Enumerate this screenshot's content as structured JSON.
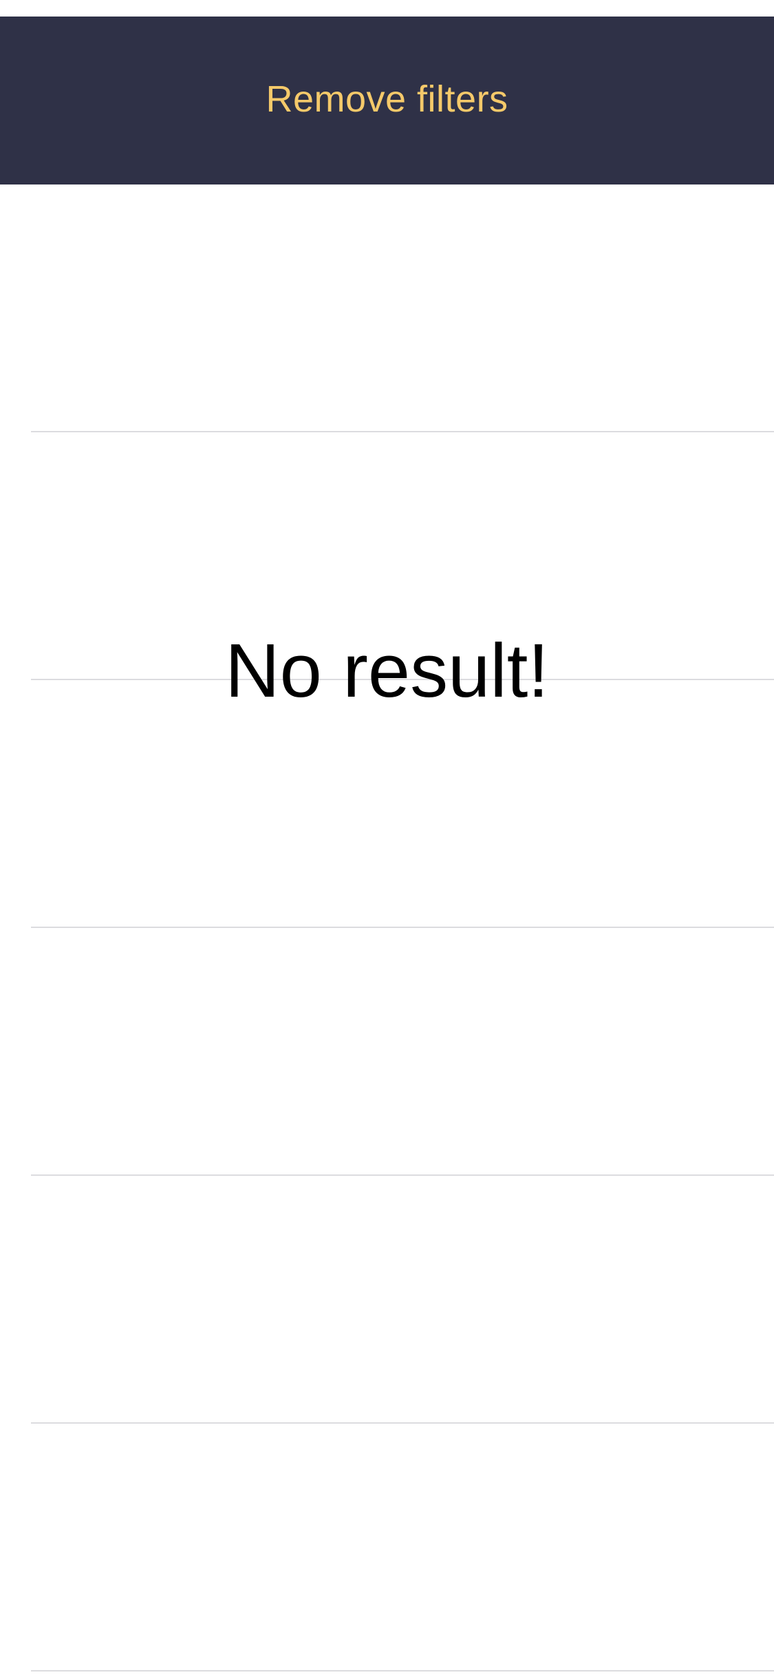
{
  "filter_bar": {
    "remove_filters_label": "Remove filters",
    "background_color": "#2f3147",
    "label_color": "#f5c96a"
  },
  "results": {
    "empty_message": "No result!",
    "row_count": 6
  }
}
